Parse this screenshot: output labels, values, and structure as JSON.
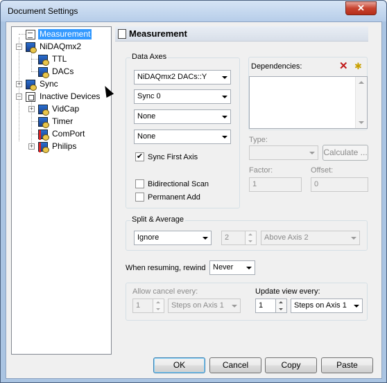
{
  "window": {
    "title": "Document Settings",
    "close_glyph": "✕"
  },
  "tree": {
    "items": [
      {
        "label": "Measurement"
      },
      {
        "label": "NiDAQmx2"
      },
      {
        "label": "TTL"
      },
      {
        "label": "DACs"
      },
      {
        "label": "Sync"
      },
      {
        "label": "Inactive Devices"
      },
      {
        "label": "VidCap"
      },
      {
        "label": "Timer"
      },
      {
        "label": "ComPort"
      },
      {
        "label": "Philips"
      }
    ],
    "expander_plus": "+",
    "expander_minus": "−"
  },
  "panel": {
    "title": "Measurement"
  },
  "data_axes": {
    "title": "Data Axes",
    "combos": [
      "NiDAQmx2 DACs::Y",
      "Sync 0",
      "None",
      "None"
    ],
    "sync_first_axis": {
      "label": "Sync First Axis",
      "checked": true,
      "mark": "✔"
    },
    "bidirectional_scan": {
      "label": "Bidirectional Scan",
      "checked": false
    },
    "permanent_add": {
      "label": "Permanent Add",
      "checked": false
    }
  },
  "dependencies": {
    "label": "Dependencies:",
    "delete_icon": "✕",
    "new_icon": "✱",
    "type_label": "Type:",
    "type_value": "",
    "calculate_label": "Calculate ...",
    "factor_label": "Factor:",
    "factor_value": "1",
    "offset_label": "Offset:",
    "offset_value": "0"
  },
  "split_average": {
    "title": "Split & Average",
    "mode": "Ignore",
    "count": "2",
    "position": "Above Axis 2"
  },
  "resume": {
    "label": "When resuming, rewind",
    "value": "Never"
  },
  "allow_cancel": {
    "label": "Allow cancel every:",
    "count": "1",
    "unit": "Steps on Axis 1"
  },
  "update_view": {
    "label": "Update view every:",
    "count": "1",
    "unit": "Steps on Axis 1"
  },
  "buttons": {
    "ok": "OK",
    "cancel": "Cancel",
    "copy": "Copy",
    "paste": "Paste"
  }
}
